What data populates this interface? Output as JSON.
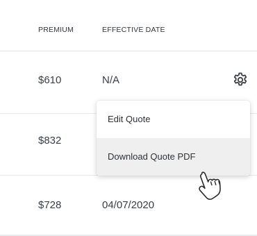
{
  "table": {
    "headers": {
      "premium": "PREMIUM",
      "effective_date": "EFFECTIVE DATE"
    },
    "rows": [
      {
        "premium": "$610",
        "effective_date": "N/A"
      },
      {
        "premium": "$832",
        "effective_date": ""
      },
      {
        "premium": "$728",
        "effective_date": "04/07/2020"
      }
    ]
  },
  "row_actions": {
    "icon": "gear-icon"
  },
  "menu": {
    "items": [
      {
        "label": "Edit Quote"
      },
      {
        "label": "Download Quote PDF",
        "hovered": true
      }
    ]
  },
  "cursor": {
    "icon": "hand-pointer-icon"
  },
  "colors": {
    "text": "#333a40",
    "divider": "#e6e8ea",
    "menu_hover_bg": "#efefef"
  }
}
